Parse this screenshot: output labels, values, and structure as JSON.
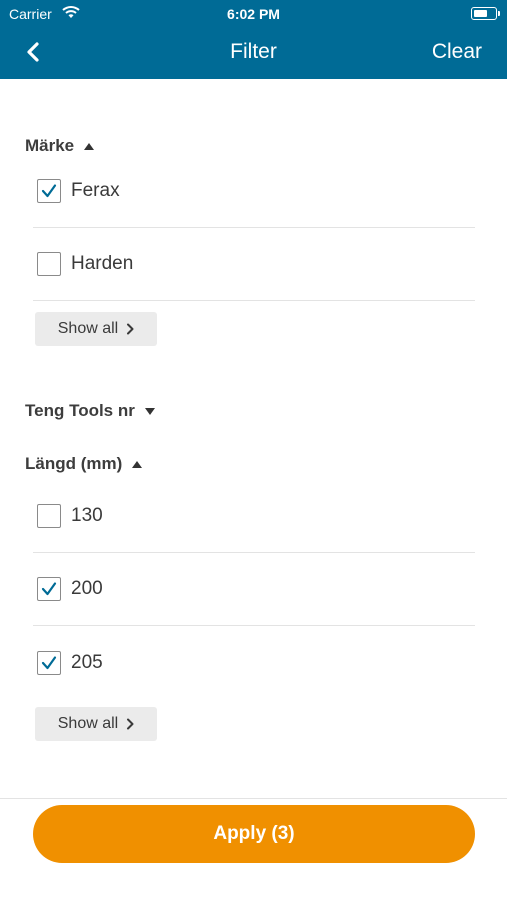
{
  "status_bar": {
    "carrier": "Carrier",
    "time": "6:02 PM",
    "wifi_icon": "wifi-icon",
    "battery_icon": "battery-icon"
  },
  "nav": {
    "back_icon": "chevron-left-icon",
    "title": "Filter",
    "clear_label": "Clear"
  },
  "filters": {
    "brand": {
      "label": "Märke",
      "expanded": true,
      "options": [
        {
          "label": "Ferax",
          "checked": true
        },
        {
          "label": "Harden",
          "checked": false
        }
      ],
      "show_all_label": "Show all"
    },
    "teng_tools": {
      "label": "Teng Tools nr",
      "expanded": false
    },
    "length": {
      "label": "Längd (mm)",
      "expanded": true,
      "options": [
        {
          "label": "130",
          "checked": false
        },
        {
          "label": "200",
          "checked": true
        },
        {
          "label": "205",
          "checked": true
        }
      ],
      "show_all_label": "Show all"
    }
  },
  "apply_label": "Apply (3)",
  "colors": {
    "header": "#006b96",
    "accent": "#f09000",
    "check": "#006b96"
  }
}
